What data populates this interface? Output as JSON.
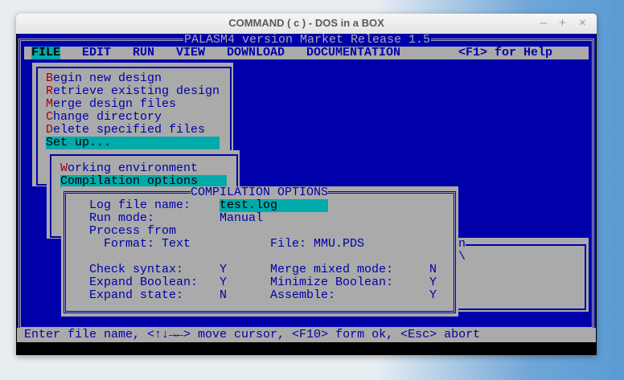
{
  "window": {
    "title": "COMMAND ( c ) - DOS in a BOX",
    "minimize": "–",
    "maximize": "+",
    "close": "×"
  },
  "app_title": "PALASM4 version Market Release 1.5",
  "menubar": {
    "items": [
      "FILE",
      "EDIT",
      "RUN",
      "VIEW",
      "DOWNLOAD",
      "DOCUMENTATION"
    ],
    "help": "<F1> for Help"
  },
  "file_menu": {
    "items": [
      {
        "hotkey": "B",
        "rest": "egin new design"
      },
      {
        "hotkey": "R",
        "rest": "etrieve existing design"
      },
      {
        "hotkey": "M",
        "rest": "erge design files"
      },
      {
        "hotkey": "C",
        "rest": "hange directory"
      },
      {
        "hotkey": "D",
        "rest": "elete specified files"
      },
      {
        "hotkey": "",
        "rest": "Set up..."
      }
    ]
  },
  "setup_menu": {
    "items": [
      {
        "hotkey": "W",
        "rest": "orking environment"
      },
      {
        "hotkey": "",
        "rest": "Compilation options"
      }
    ]
  },
  "background_dialog": {
    "title_fragment": "on",
    "glyph": "\\"
  },
  "dialog": {
    "title": "COMPILATION OPTIONS",
    "log_label": "Log file name:",
    "log_value": "test.log",
    "run_label": "Run mode:",
    "run_value": "Manual",
    "process_label": "Process from",
    "format_label": "Format: Text",
    "file_label": "File: MMU.PDS",
    "options": [
      {
        "label": "Check syntax:",
        "value": "Y",
        "label2": "Merge mixed mode:",
        "value2": "N"
      },
      {
        "label": "Expand Boolean:",
        "value": "Y",
        "label2": "Minimize Boolean:",
        "value2": "Y"
      },
      {
        "label": "Expand state:",
        "value": "N",
        "label2": "Assemble:",
        "value2": "Y"
      }
    ]
  },
  "status_line": "Enter file name, <↑↓→←> move cursor, <F10> form ok, <Esc> abort",
  "colors": {
    "background": "#0000aa",
    "panel": "#aaaaaa",
    "highlight": "#00aaaa",
    "hotkey": "#aa0000"
  }
}
